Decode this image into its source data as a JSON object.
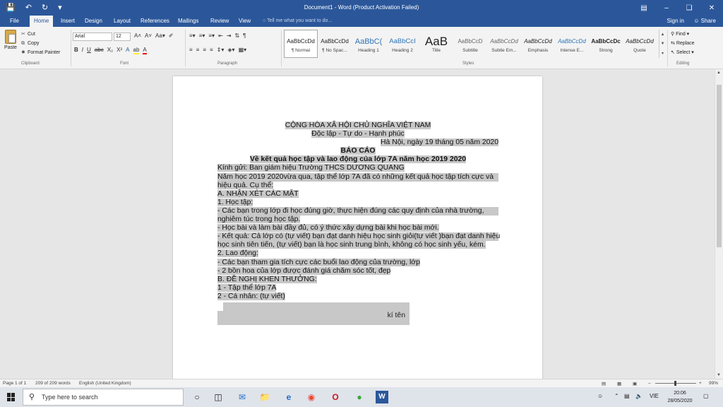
{
  "titlebar": {
    "title": "Document1 - Word (Product Activation Failed)",
    "save_icon": "save-icon",
    "undo_icon": "undo-icon",
    "redo_icon": "redo-icon"
  },
  "tabs": {
    "items": [
      "File",
      "Home",
      "Insert",
      "Design",
      "Layout",
      "References",
      "Mailings",
      "Review",
      "View"
    ],
    "tell_me": "Tell me what you want to do...",
    "sign_in": "Sign in",
    "share": "Share"
  },
  "clipboard": {
    "paste": "Paste",
    "cut": "Cut",
    "copy": "Copy",
    "format_painter": "Format Painter",
    "label": "Clipboard"
  },
  "font": {
    "name": "Arial",
    "size": "12",
    "label": "Font"
  },
  "paragraph": {
    "label": "Paragraph"
  },
  "styles": {
    "label": "Styles",
    "items": [
      {
        "preview": "AaBbCcDd",
        "name": "¶ Normal"
      },
      {
        "preview": "AaBbCcDd",
        "name": "¶ No Spac..."
      },
      {
        "preview": "AaBbC(",
        "name": "Heading 1"
      },
      {
        "preview": "AaBbCcI",
        "name": "Heading 2"
      },
      {
        "preview": "AaB",
        "name": "Title"
      },
      {
        "preview": "AaBbCcD",
        "name": "Subtitle"
      },
      {
        "preview": "AaBbCcDd",
        "name": "Subtle Em..."
      },
      {
        "preview": "AaBbCcDd",
        "name": "Emphasis"
      },
      {
        "preview": "AaBbCcDd",
        "name": "Intense E..."
      },
      {
        "preview": "AaBbCcDc",
        "name": "Strong"
      },
      {
        "preview": "AaBbCcDd",
        "name": "Quote"
      }
    ]
  },
  "editing": {
    "find": "Find",
    "replace": "Replace",
    "select": "Select",
    "label": "Editing"
  },
  "document": {
    "lines": [
      "CỘNG HÒA XÃ HỘI CHỦ NGHĨA VIỆT NAM",
      "Độc lập - Tự do - Hạnh phúc",
      "Hà Nội, ngày 19 tháng 05 năm 2020",
      "BÁO CÁO",
      "Về kết quả học tập và lao động của lớp 7A năm học 2019 2020",
      "Kính gửi: Ban giám hiệu Trường THCS DƯƠNG QUANG",
      "Năm học 2019 2020vừa qua, tập thể lớp 7A đã có những kết quả học tập tích cực và",
      "hiệu quả. Cụ thể:",
      "A. NHẬN XÉT CÁC MẶT",
      "1. Học tập:",
      "- Các bạn trong lớp đi học đúng giờ, thực hiện đúng các quy định của nhà trường,",
      "nghiêm túc trong học tập.",
      "- Học bài và làm bài đầy đủ, có ý thức xây dựng bài khi học bài mới.",
      "- Kết quả: Cả lớp có (tự viết) bạn đạt danh hiệu học sinh giỏi(tự viết )bạn đạt danh hiệu",
      "học sinh tiên tiến, (tự viết) bạn là học sinh trung bình, không có học sinh yếu, kém.",
      "2. Lao động:",
      "- Các bạn tham gia tích cực các buổi lao động của trường, lớp",
      "- 2 bồn hoa của lớp được đánh giá chăm sóc tốt, đẹp",
      "B. ĐỀ NGHỊ KHEN THƯỞNG:",
      "1 - Tập thể lớp 7A",
      "2 - Cá nhân: (tự viết)"
    ],
    "signature": "kí tên"
  },
  "status": {
    "page": "Page 1 of 1",
    "words": "209 of 209 words",
    "language": "English (United Kingdom)",
    "zoom": "99%"
  },
  "taskbar": {
    "search_placeholder": "Type here to search",
    "lang": "VIE",
    "time": "20:06",
    "date": "28/05/2020"
  },
  "colors": {
    "brand": "#2b579a",
    "highlight": "#c8c8c8"
  }
}
